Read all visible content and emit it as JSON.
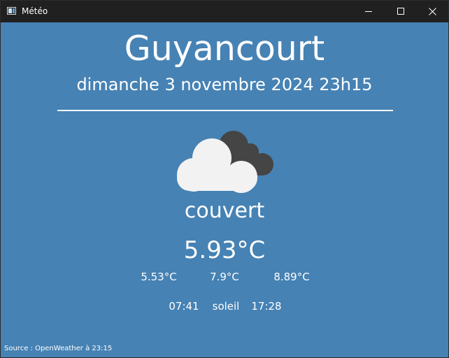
{
  "window": {
    "title": "Météo",
    "controls": {
      "minimize_icon": "minimize-icon",
      "maximize_icon": "maximize-icon",
      "close_icon": "close-icon"
    }
  },
  "weather": {
    "city": "Guyancourt",
    "datetime": "dimanche 3 novembre 2024 23h15",
    "icon": "overcast-clouds-icon",
    "description": "couvert",
    "temperature": "5.93°C",
    "temp_min": "5.53°C",
    "feels_like": "7.9°C",
    "temp_max": "8.89°C",
    "sunrise": "07:41",
    "sun_label": "soleil",
    "sunset": "17:28"
  },
  "footer": {
    "source": "Source : OpenWeather à 23:15"
  },
  "colors": {
    "background": "#4682b4",
    "titlebar": "#202020",
    "text": "#ffffff",
    "cloud_front": "#f2f2f2",
    "cloud_back": "#454545"
  }
}
